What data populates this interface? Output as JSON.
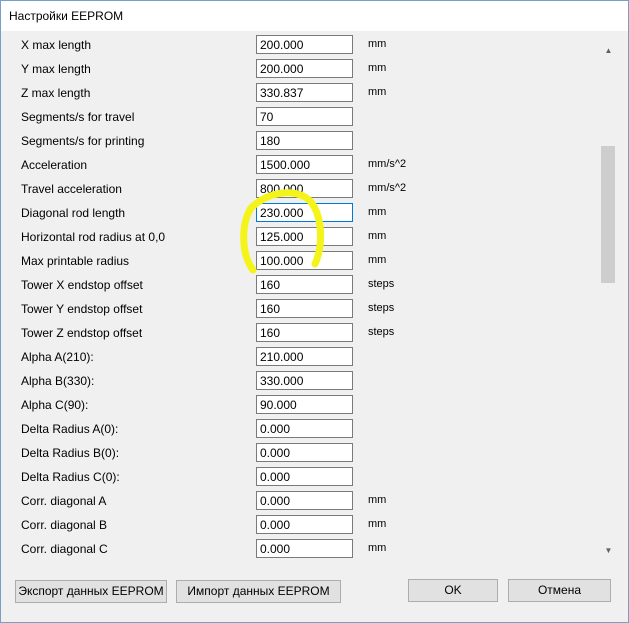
{
  "window": {
    "title": "Настройки EEPROM"
  },
  "rows": [
    {
      "label": "X max length",
      "value": "200.000",
      "unit": "mm"
    },
    {
      "label": "Y max length",
      "value": "200.000",
      "unit": "mm"
    },
    {
      "label": "Z max length",
      "value": "330.837",
      "unit": "mm"
    },
    {
      "label": "Segments/s for travel",
      "value": "70",
      "unit": ""
    },
    {
      "label": "Segments/s for printing",
      "value": "180",
      "unit": ""
    },
    {
      "label": "Acceleration",
      "value": "1500.000",
      "unit": "mm/s^2"
    },
    {
      "label": "Travel acceleration",
      "value": "800.000",
      "unit": "mm/s^2"
    },
    {
      "label": "Diagonal rod length",
      "value": "230.000",
      "unit": "mm"
    },
    {
      "label": "Horizontal rod radius at 0,0",
      "value": "125.000",
      "unit": "mm"
    },
    {
      "label": "Max printable radius",
      "value": "100.000",
      "unit": "mm"
    },
    {
      "label": "Tower X endstop offset",
      "value": "160",
      "unit": "steps"
    },
    {
      "label": "Tower Y endstop offset",
      "value": "160",
      "unit": "steps"
    },
    {
      "label": "Tower Z endstop offset",
      "value": "160",
      "unit": "steps"
    },
    {
      "label": "Alpha A(210):",
      "value": "210.000",
      "unit": ""
    },
    {
      "label": "Alpha B(330):",
      "value": "330.000",
      "unit": ""
    },
    {
      "label": "Alpha C(90):",
      "value": "90.000",
      "unit": ""
    },
    {
      "label": "Delta Radius A(0):",
      "value": "0.000",
      "unit": ""
    },
    {
      "label": "Delta Radius B(0):",
      "value": "0.000",
      "unit": ""
    },
    {
      "label": "Delta Radius C(0):",
      "value": "0.000",
      "unit": ""
    },
    {
      "label": "Corr. diagonal A",
      "value": "0.000",
      "unit": "mm"
    },
    {
      "label": "Corr. diagonal B",
      "value": "0.000",
      "unit": "mm"
    },
    {
      "label": "Corr. diagonal C",
      "value": "0.000",
      "unit": "mm"
    }
  ],
  "buttons": {
    "export": "Экспорт данных EEPROM",
    "import": "Импорт данных EEPROM",
    "ok": "OK",
    "cancel": "Отмена"
  },
  "highlight_color": "#f4f41a",
  "focus_color": "#0078d7",
  "icons": {
    "scroll_up": "scroll-up-arrow-icon",
    "scroll_down": "scroll-down-arrow-icon"
  }
}
